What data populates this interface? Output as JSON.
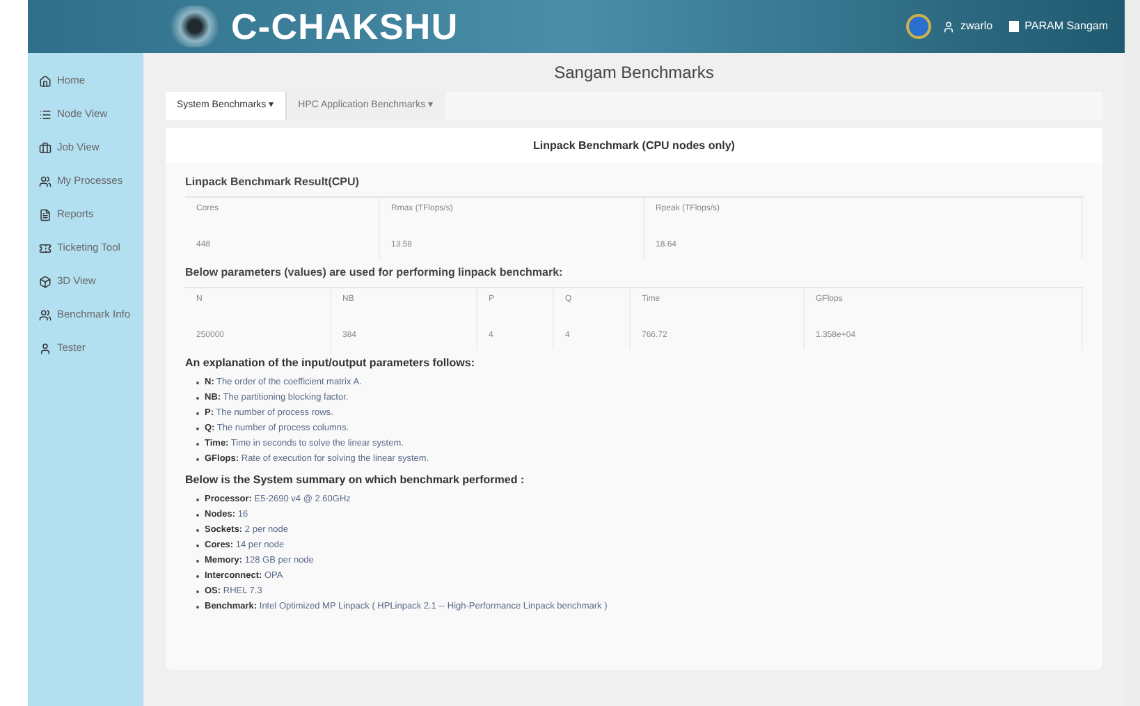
{
  "header": {
    "logo": "C-CHAKSHU",
    "user": "zwarlo",
    "project": "PARAM Sangam"
  },
  "sidebar": {
    "items": [
      {
        "label": "Home"
      },
      {
        "label": "Node View"
      },
      {
        "label": "Job View"
      },
      {
        "label": "My Processes"
      },
      {
        "label": "Reports"
      },
      {
        "label": "Ticketing Tool"
      },
      {
        "label": "3D View"
      },
      {
        "label": "Benchmark Info"
      },
      {
        "label": "Tester"
      }
    ]
  },
  "page_title": "Sangam Benchmarks",
  "tabs": [
    {
      "label": "System Benchmarks ▾",
      "selected": true
    },
    {
      "label": "HPC Application Benchmarks ▾",
      "selected": false
    }
  ],
  "card_title": "Linpack Benchmark (CPU nodes only)",
  "result": {
    "title": "Linpack Benchmark Result(CPU)",
    "columns": [
      "Cores",
      "Rmax (TFlops/s)",
      "Rpeak (TFlops/s)"
    ],
    "row": [
      "448",
      "13.58",
      "18.64"
    ]
  },
  "params": {
    "title": "Below parameters (values) are used for performing linpack benchmark:",
    "columns": [
      "N",
      "NB",
      "P",
      "Q",
      "Time",
      "GFlops"
    ],
    "row": [
      "250000",
      "384",
      "4",
      "4",
      "766.72",
      "1.358e+04"
    ]
  },
  "explanation": {
    "title": "An explanation of the input/output parameters follows:",
    "items": [
      "**N:** The order of the coefficient matrix A.",
      "**NB:** The partitioning blocking factor.",
      "**P:** The number of process rows.",
      "**Q:** The number of process columns.",
      "**Time:** Time in seconds to solve the linear system.",
      "**GFlops:** Rate of execution for solving the linear system."
    ]
  },
  "summary": {
    "title": "Below is the System summary on which benchmark performed :",
    "items": [
      "**Processor:** E5-2690 v4 @ 2.60GHz",
      "**Nodes:** 16",
      "**Sockets:** 2 per node",
      "**Cores:** 14 per node",
      "**Memory:** 128 GB per node",
      "**Interconnect:** OPA",
      "**OS:** RHEL 7.3",
      "**Benchmark:** Intel Optimized MP Linpack ( HPLinpack 2.1 -- High-Performance Linpack benchmark )"
    ]
  }
}
